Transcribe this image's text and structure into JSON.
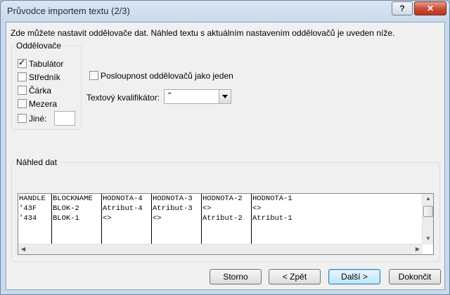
{
  "window": {
    "title": "Průvodce importem textu (2/3)",
    "help_label": "?",
    "close_label": "✕"
  },
  "description": "Zde můžete nastavit oddělovače dat. Náhled textu s aktuálním nastavením oddělovačů je uveden níže.",
  "delimiters": {
    "legend": "Oddělovače",
    "items": [
      {
        "label": "Tabulátor",
        "checked": true
      },
      {
        "label": "Středník",
        "checked": false
      },
      {
        "label": "Čárka",
        "checked": false
      },
      {
        "label": "Mezera",
        "checked": false
      },
      {
        "label": "Jiné:",
        "checked": false
      }
    ],
    "other_value": ""
  },
  "consecutive": {
    "label": "Posloupnost oddělovačů jako jeden",
    "checked": false
  },
  "qualifier": {
    "label": "Textový kvalifikátor:",
    "value": "\""
  },
  "preview": {
    "legend": "Náhled dat",
    "columns": [
      {
        "header": "HANDLE",
        "rows": [
          "'43F",
          "'434"
        ]
      },
      {
        "header": "BLOCKNAME",
        "rows": [
          "BLOK-2",
          "BLOK-1"
        ]
      },
      {
        "header": "HODNOTA-4",
        "rows": [
          "Atribut-4",
          "<>"
        ]
      },
      {
        "header": "HODNOTA-3",
        "rows": [
          "Atribut-3",
          "<>"
        ]
      },
      {
        "header": "HODNOTA-2",
        "rows": [
          "<>",
          "Atribut-2"
        ]
      },
      {
        "header": "HODNOTA-1",
        "rows": [
          "<>",
          "Atribut-1"
        ]
      }
    ]
  },
  "buttons": {
    "cancel": "Storno",
    "back": "< Zpět",
    "next": "Další >",
    "finish": "Dokončit"
  }
}
